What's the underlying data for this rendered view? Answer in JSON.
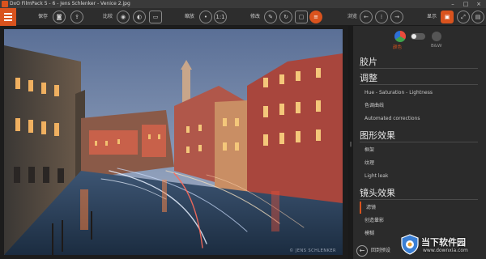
{
  "window": {
    "title": "DxO FilmPack 5 - 6 - Jens Schlenker - Venice 2.jpg",
    "minimize": "–",
    "maximize": "□",
    "close": "×"
  },
  "toolbar": {
    "save_label": "保存",
    "compare_label": "比较",
    "zoom_label": "缩放",
    "zoom_fit": "1:1",
    "edit_label": "修改",
    "browse_label": "浏览",
    "display_label": "显示"
  },
  "viewer": {
    "watermark": "© JENS SCHLENKER"
  },
  "panel": {
    "mode_color": "颜色",
    "mode_bw": "B&W",
    "sections": [
      {
        "title": "胶片",
        "items": []
      },
      {
        "title": "调整",
        "items": [
          "Hue - Saturation - Lightness",
          "色调曲线",
          "Automated corrections"
        ]
      },
      {
        "title": "图形效果",
        "items": [
          "框架",
          "纹理",
          "Light leak"
        ]
      },
      {
        "title": "镜头效果",
        "items": [
          "滤镜",
          "创造暈影",
          "模糊"
        ]
      }
    ],
    "back_label": "回到预设"
  },
  "site": {
    "name": "当下软件园",
    "url": "www.downxia.com"
  },
  "colors": {
    "accent": "#d9531e"
  }
}
